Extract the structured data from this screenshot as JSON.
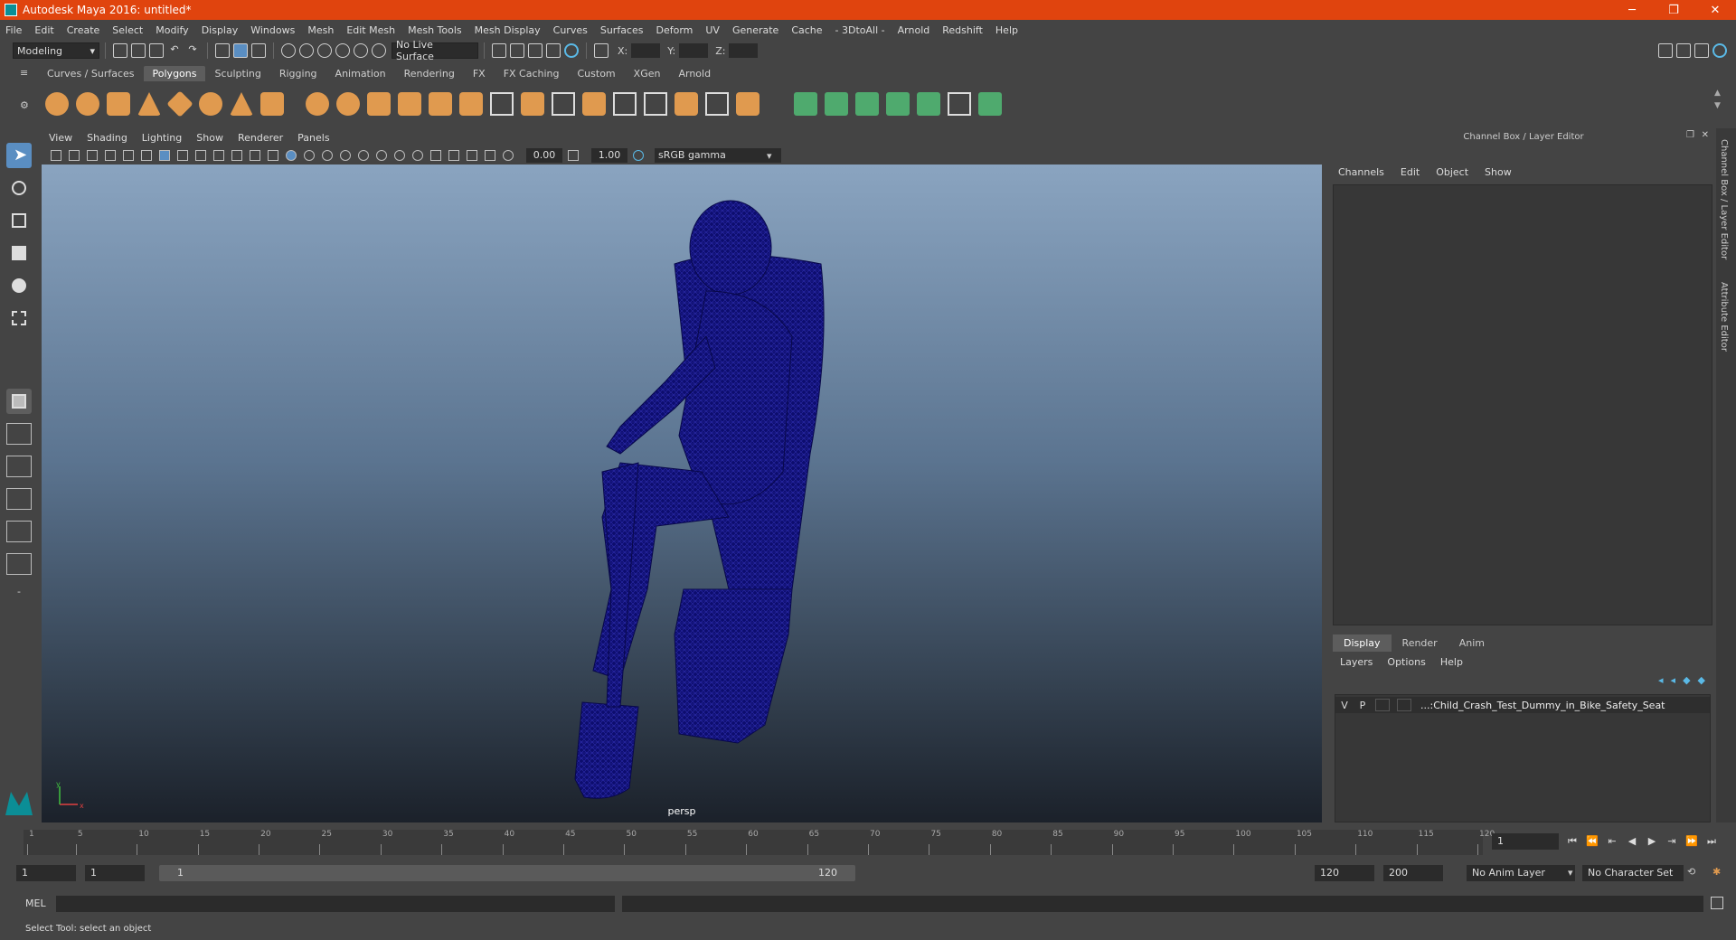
{
  "window": {
    "title": "Autodesk Maya 2016: untitled*",
    "controls": [
      "─",
      "❐",
      "✕"
    ]
  },
  "menubar": [
    "File",
    "Edit",
    "Create",
    "Select",
    "Modify",
    "Display",
    "Windows",
    "Mesh",
    "Edit Mesh",
    "Mesh Tools",
    "Mesh Display",
    "Curves",
    "Surfaces",
    "Deform",
    "UV",
    "Generate",
    "Cache",
    "- 3DtoAll -",
    "Arnold",
    "Redshift",
    "Help"
  ],
  "statusline": {
    "mode": "Modeling",
    "live_surface": "No Live Surface",
    "x_label": "X:",
    "y_label": "Y:",
    "z_label": "Z:"
  },
  "shelf_tabs": [
    "Curves / Surfaces",
    "Polygons",
    "Sculpting",
    "Rigging",
    "Animation",
    "Rendering",
    "FX",
    "FX Caching",
    "Custom",
    "XGen",
    "Arnold"
  ],
  "shelf_active": "Polygons",
  "viewport": {
    "menu": [
      "View",
      "Shading",
      "Lighting",
      "Show",
      "Renderer",
      "Panels"
    ],
    "exposure": "0.00",
    "gamma": "1.00",
    "colorspace": "sRGB gamma",
    "camera_label": "persp",
    "axis_x": "x",
    "axis_y": "y",
    "wire_color": "#0d0d6e"
  },
  "channel_box": {
    "header": "Channel Box / Layer Editor",
    "menu": [
      "Channels",
      "Edit",
      "Object",
      "Show"
    ]
  },
  "layer_editor": {
    "tabs": [
      "Display",
      "Render",
      "Anim"
    ],
    "active_tab": "Display",
    "menu": [
      "Layers",
      "Options",
      "Help"
    ],
    "layers": [
      {
        "v": "V",
        "p": "P",
        "name": "...:Child_Crash_Test_Dummy_in_Bike_Safety_Seat"
      }
    ]
  },
  "side_tabs": [
    "Channel Box / Layer Editor",
    "Attribute Editor"
  ],
  "timeline": {
    "ticks": [
      "1",
      "5",
      "10",
      "15",
      "20",
      "25",
      "30",
      "35",
      "40",
      "45",
      "50",
      "55",
      "60",
      "65",
      "70",
      "75",
      "80",
      "85",
      "90",
      "95",
      "100",
      "105",
      "110",
      "115",
      "120"
    ],
    "current_frame": "1",
    "playback_icons": [
      "⏮",
      "⏪",
      "⇤",
      "◀",
      "▶",
      "⇥",
      "⏩",
      "⏭"
    ]
  },
  "range": {
    "start": "1",
    "playback_start": "1",
    "slider_start": "1",
    "slider_end": "120",
    "playback_end": "120",
    "end": "200",
    "anim_layer": "No Anim Layer",
    "char_set": "No Character Set"
  },
  "command_line": {
    "label": "MEL"
  },
  "help_line": "Select Tool: select an object"
}
